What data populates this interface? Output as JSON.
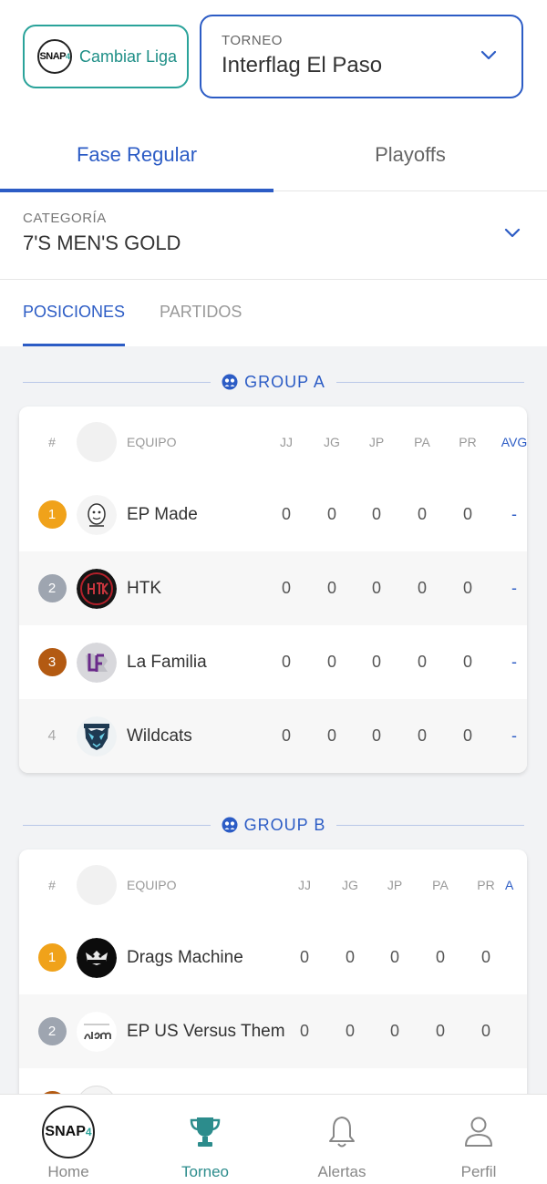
{
  "header": {
    "league_button_label": "Cambiar Liga",
    "league_logo_text": "SNAP",
    "tournament_label": "TORNEO",
    "tournament_value": "Interflag El Paso"
  },
  "phase_tabs": [
    {
      "label": "Fase Regular",
      "active": true
    },
    {
      "label": "Playoffs",
      "active": false
    }
  ],
  "category": {
    "label": "CATEGORÍA",
    "value": "7'S MEN'S GOLD"
  },
  "sub_tabs": [
    {
      "label": "POSICIONES",
      "active": true
    },
    {
      "label": "PARTIDOS",
      "active": false
    }
  ],
  "columns": {
    "rank": "#",
    "team": "EQUIPO",
    "jj": "JJ",
    "jg": "JG",
    "jp": "JP",
    "pa": "PA",
    "pr": "PR",
    "avg": "AVG",
    "avg_partial": "A"
  },
  "groups": [
    {
      "title": "GROUP A",
      "rows": [
        {
          "rank": "1",
          "team": "EP Made",
          "jj": "0",
          "jg": "0",
          "jp": "0",
          "pa": "0",
          "pr": "0",
          "avg": "-"
        },
        {
          "rank": "2",
          "team": "HTK",
          "jj": "0",
          "jg": "0",
          "jp": "0",
          "pa": "0",
          "pr": "0",
          "avg": "-"
        },
        {
          "rank": "3",
          "team": "La Familia",
          "jj": "0",
          "jg": "0",
          "jp": "0",
          "pa": "0",
          "pr": "0",
          "avg": "-"
        },
        {
          "rank": "4",
          "team": "Wildcats",
          "jj": "0",
          "jg": "0",
          "jp": "0",
          "pa": "0",
          "pr": "0",
          "avg": "-"
        }
      ]
    },
    {
      "title": "GROUP B",
      "rows": [
        {
          "rank": "1",
          "team": "Drags Machine",
          "jj": "0",
          "jg": "0",
          "jp": "0",
          "pa": "0",
          "pr": "0"
        },
        {
          "rank": "2",
          "team": "EP US Versus Them",
          "jj": "0",
          "jg": "0",
          "jp": "0",
          "pa": "0",
          "pr": "0"
        }
      ]
    }
  ],
  "bottom_nav": [
    {
      "label": "Home",
      "icon": "snap-logo-icon",
      "active": false
    },
    {
      "label": "Torneo",
      "icon": "trophy-icon",
      "active": true
    },
    {
      "label": "Alertas",
      "icon": "bell-icon",
      "active": false
    },
    {
      "label": "Perfil",
      "icon": "user-icon",
      "active": false
    }
  ],
  "colors": {
    "primary_blue": "#2c5cc5",
    "teal": "#2aa39a",
    "gold": "#f0a21a",
    "silver": "#9ea5b0",
    "bronze": "#b35a12",
    "content_bg": "#f2f3f5"
  }
}
